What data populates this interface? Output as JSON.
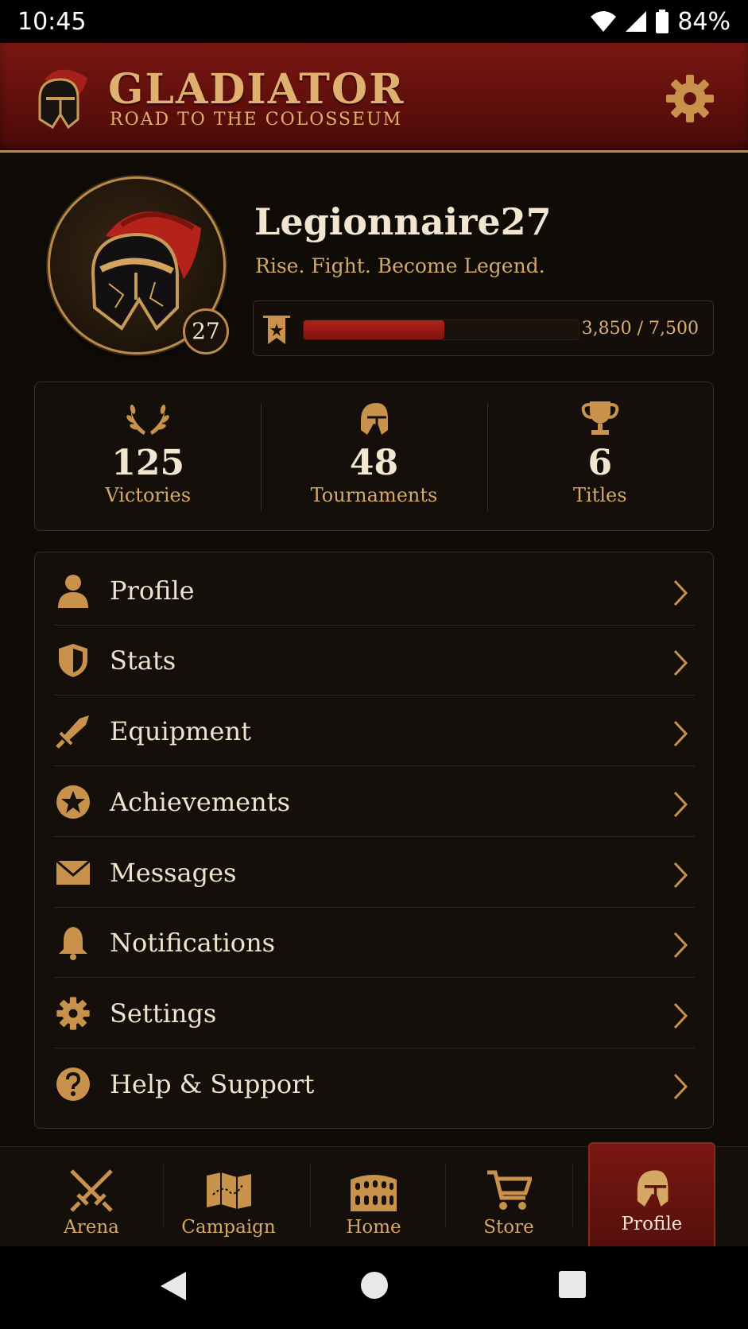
{
  "status_bar": {
    "time": "10:45",
    "battery": "84%"
  },
  "header": {
    "title": "GLADIATOR",
    "subtitle": "ROAD TO THE COLOSSEUM"
  },
  "profile": {
    "username": "Legionnaire27",
    "tagline": "Rise. Fight. Become Legend.",
    "level": "27",
    "xp_text": "3,850 / 7,500",
    "xp_progress": 0.513
  },
  "stats": [
    {
      "value": "125",
      "label": "Victories",
      "icon": "laurel-icon"
    },
    {
      "value": "48",
      "label": "Tournaments",
      "icon": "helmet-icon"
    },
    {
      "value": "6",
      "label": "Titles",
      "icon": "trophy-icon"
    }
  ],
  "menu": [
    {
      "label": "Profile",
      "icon": "person-icon"
    },
    {
      "label": "Stats",
      "icon": "shield-icon"
    },
    {
      "label": "Equipment",
      "icon": "sword-icon"
    },
    {
      "label": "Achievements",
      "icon": "star-badge-icon"
    },
    {
      "label": "Messages",
      "icon": "envelope-icon"
    },
    {
      "label": "Notifications",
      "icon": "bell-icon"
    },
    {
      "label": "Settings",
      "icon": "gear-icon"
    },
    {
      "label": "Help & Support",
      "icon": "help-icon"
    }
  ],
  "bottom_nav": [
    {
      "label": "Arena",
      "icon": "crossed-swords-icon"
    },
    {
      "label": "Campaign",
      "icon": "map-icon"
    },
    {
      "label": "Home",
      "icon": "colosseum-icon"
    },
    {
      "label": "Store",
      "icon": "cart-icon"
    },
    {
      "label": "Profile",
      "icon": "helmet-icon",
      "active": true
    }
  ],
  "colors": {
    "accent_gold": "#d6a866",
    "accent_red": "#7a1712",
    "background": "#0f0c08"
  }
}
